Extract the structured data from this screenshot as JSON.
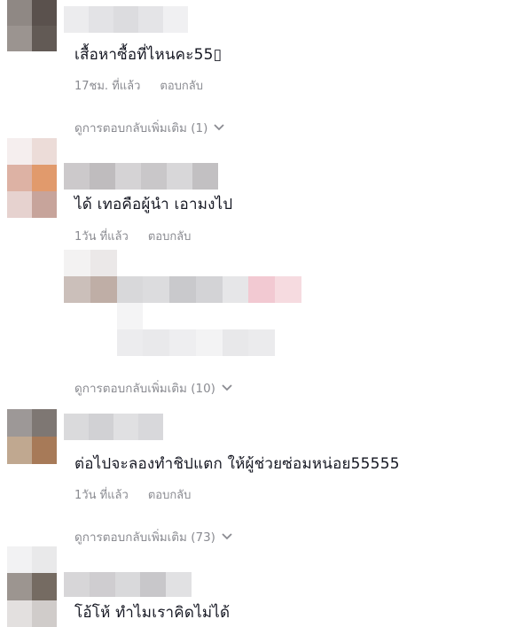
{
  "comments": [
    {
      "text": "เสื้อหาซื้อที่ไหนคะ55▯",
      "time": "17ชม. ที่แล้ว",
      "reply_label": "ตอบกลับ",
      "more_replies": "ดูการตอบกลับเพิ่มเติม (1)"
    },
    {
      "text": "ได้ เทอคือผู้นำ เอามงไป",
      "time": "1วัน ที่แล้ว",
      "reply_label": "ตอบกลับ",
      "more_replies": "ดูการตอบกลับเพิ่มเติม (10)"
    },
    {
      "text": "ต่อไปจะลองทำชิปแตก ให้ผู้ช่วยซ่อมหน่อย55555",
      "time": "1วัน ที่แล้ว",
      "reply_label": "ตอบกลับ",
      "more_replies": "ดูการตอบกลับเพิ่มเติม (73)"
    },
    {
      "text": "โอ้โห้ ทำไมเราคิดไม่ได้"
    }
  ],
  "icons": {
    "expand": "chevron-down-icon",
    "avatar": "pixelated-avatar"
  },
  "colors": {
    "text": "#161823",
    "secondary": "#8a8b91"
  }
}
